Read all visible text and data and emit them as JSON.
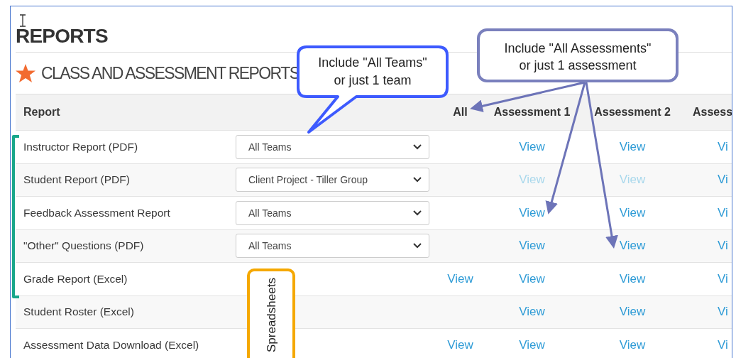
{
  "page_title": "REPORTS",
  "section_title": "CLASS AND ASSESSMENT REPORTS",
  "table": {
    "report_heading": "Report",
    "all_heading": "All",
    "assessment_headings": [
      "Assessment 1",
      "Assessment 2",
      "Assess"
    ],
    "rows": [
      {
        "report": "Instructor Report (PDF)",
        "team": "All Teams",
        "cells": [
          null,
          {
            "label": "View",
            "disabled": false
          },
          {
            "label": "View",
            "disabled": false
          },
          {
            "label": "Vi",
            "disabled": false
          }
        ]
      },
      {
        "report": "Student Report (PDF)",
        "team": "Client Project - Tiller Group",
        "cells": [
          null,
          {
            "label": "View",
            "disabled": true
          },
          {
            "label": "View",
            "disabled": true
          },
          {
            "label": "Vi",
            "disabled": false
          }
        ]
      },
      {
        "report": "Feedback Assessment Report",
        "team": "All Teams",
        "cells": [
          null,
          {
            "label": "View",
            "disabled": false
          },
          {
            "label": "View",
            "disabled": false
          },
          {
            "label": "Vi",
            "disabled": false
          }
        ]
      },
      {
        "report": "\"Other\" Questions (PDF)",
        "team": "All Teams",
        "cells": [
          null,
          {
            "label": "View",
            "disabled": false
          },
          {
            "label": "View",
            "disabled": false
          },
          {
            "label": "Vi",
            "disabled": false
          }
        ]
      },
      {
        "report": "Grade Report (Excel)",
        "team": null,
        "cells": [
          {
            "label": "View",
            "disabled": false
          },
          {
            "label": "View",
            "disabled": false
          },
          {
            "label": "View",
            "disabled": false
          },
          {
            "label": "Vi",
            "disabled": false
          }
        ]
      },
      {
        "report": "Student Roster (Excel)",
        "team": null,
        "cells": [
          null,
          {
            "label": "View",
            "disabled": false
          },
          {
            "label": "View",
            "disabled": false
          },
          {
            "label": "Vi",
            "disabled": false
          }
        ]
      },
      {
        "report": "Assessment Data Download (Excel)",
        "team": null,
        "cells": [
          {
            "label": "View",
            "disabled": false
          },
          {
            "label": "View",
            "disabled": false
          },
          {
            "label": "View",
            "disabled": false
          },
          {
            "label": "Vi",
            "disabled": false
          }
        ]
      }
    ]
  },
  "annotations": {
    "team_callout": [
      "Include \"All Teams\"",
      "or just 1 team"
    ],
    "assessment_callout": [
      "Include \"All Assessments\"",
      "or just 1 assessment"
    ],
    "spreadsheet_label": "Spreadsheets"
  }
}
